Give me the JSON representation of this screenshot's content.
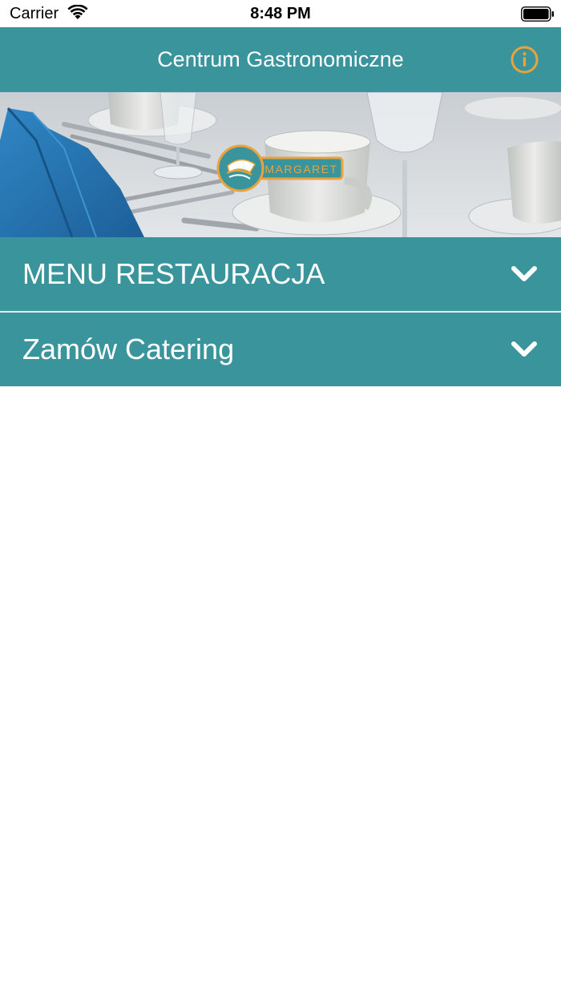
{
  "status_bar": {
    "carrier": "Carrier",
    "time": "8:48 PM"
  },
  "header": {
    "title": "Centrum Gastronomiczne",
    "info_icon": "info-circle-icon"
  },
  "banner": {
    "logo_text": "MARGARET"
  },
  "accordion": [
    {
      "label": "MENU RESTAURACJA",
      "icon": "chevron-down-icon"
    },
    {
      "label": "Zamów Catering",
      "icon": "chevron-down-icon"
    }
  ],
  "colors": {
    "primary": "#3a949c",
    "accent": "#e8a33c",
    "white": "#ffffff"
  }
}
